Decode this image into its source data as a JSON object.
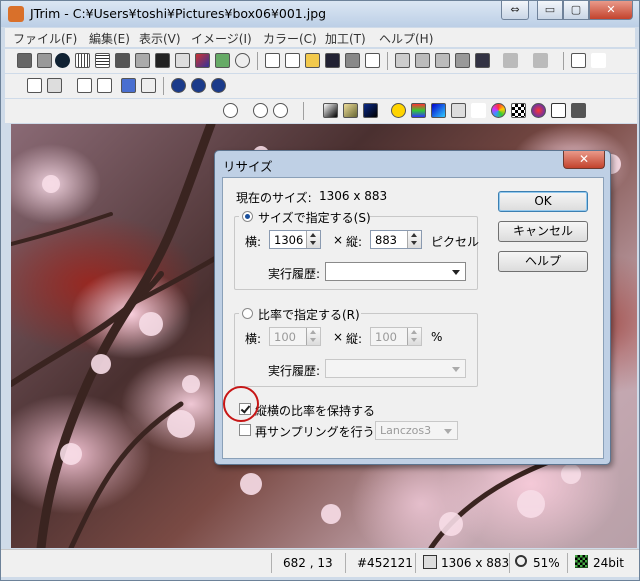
{
  "window": {
    "title": "JTrim - C:¥Users¥toshi¥Pictures¥box06¥001.jpg"
  },
  "caption_buttons": {
    "restore": "⇔",
    "minimize": "▭",
    "maximize": "▢",
    "close": "✕"
  },
  "menu": [
    "ファイル(F)",
    "編集(E)",
    "表示(V)",
    "イメージ(I)",
    "カラー(C)",
    "加工(T)",
    "ヘルプ(H)"
  ],
  "status": {
    "position": "682 , 13",
    "color": "#452121",
    "size": "1306 x 883",
    "zoom": "51%",
    "depth": "24bit"
  },
  "dialog": {
    "title": "リサイズ",
    "current_label": "現在のサイズ:",
    "current_value": "1306 x 883",
    "by_size_label": "サイズで指定する(S)",
    "width_label": "横:",
    "width_value": "1306",
    "times": "×",
    "height_label": "縦:",
    "height_value": "883",
    "unit_pixel": "ピクセル",
    "history_label": "実行履歴:",
    "by_ratio_label": "比率で指定する(R)",
    "ratio_width_label": "横:",
    "ratio_width_value": "100",
    "ratio_height_label": "縦:",
    "ratio_height_value": "100",
    "unit_percent": "%",
    "ratio_history_label": "実行履歴:",
    "keep_aspect_label": "縦横の比率を保持する",
    "resample_label": "再サンプリングを行う",
    "resample_method": "Lanczos3",
    "ok_label": "OK",
    "cancel_label": "キャンセル",
    "help_label": "ヘルプ"
  }
}
